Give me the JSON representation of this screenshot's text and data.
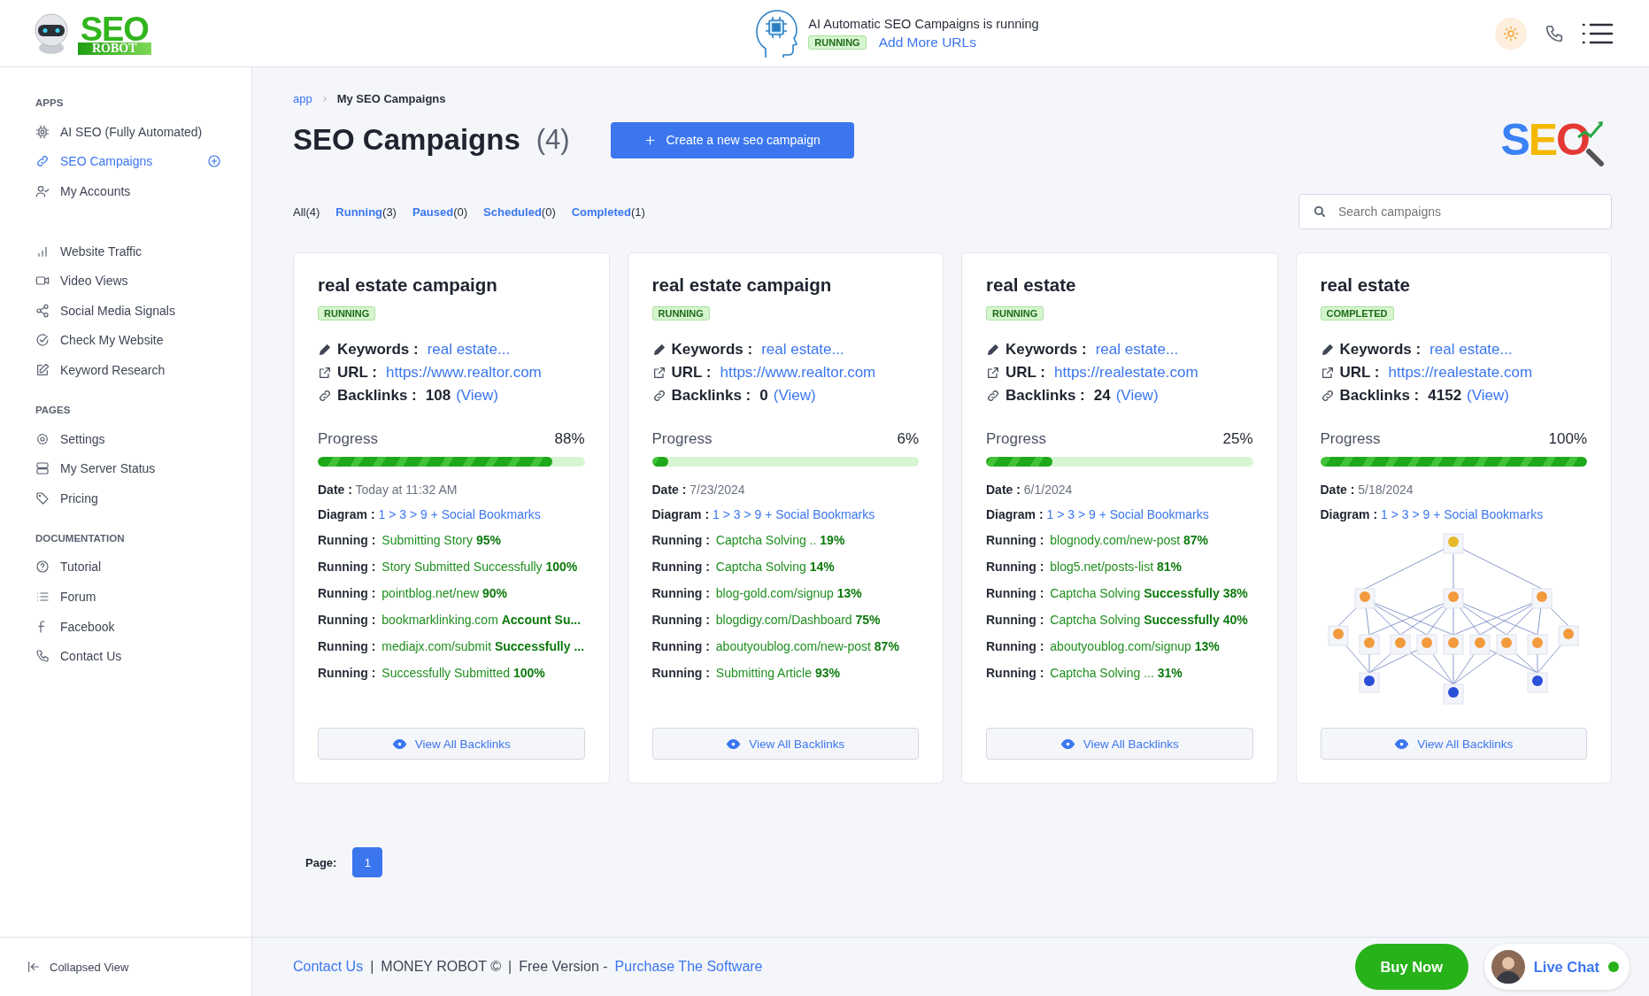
{
  "header": {
    "logo": {
      "title": "SEO",
      "subtitle": "ROBOT"
    },
    "status_text": "AI Automatic SEO Campaigns is running",
    "status_badge": "RUNNING",
    "link": "Add More URLs"
  },
  "sidebar": {
    "sections": [
      {
        "title": "APPS",
        "items": [
          {
            "label": "AI SEO (Fully Automated)",
            "selected": false,
            "kind": "plain"
          },
          {
            "label": "SEO Campaigns",
            "selected": true,
            "kind": "with-add"
          },
          {
            "label": "My Accounts",
            "selected": false,
            "kind": "plain"
          }
        ]
      },
      {
        "items": [
          {
            "label": "Website Traffic",
            "selected": false,
            "kind": "plain"
          },
          {
            "label": "Video Views",
            "selected": false,
            "kind": "plain"
          },
          {
            "label": "Social Media Signals",
            "selected": false,
            "kind": "plain"
          },
          {
            "label": "Check My Website",
            "selected": false,
            "kind": "plain"
          },
          {
            "label": "Keyword Research",
            "selected": false,
            "kind": "plain"
          }
        ]
      },
      {
        "title": "PAGES",
        "items": [
          {
            "label": "Settings",
            "selected": false,
            "kind": "plain"
          },
          {
            "label": "My Server Status",
            "selected": false,
            "kind": "plain"
          },
          {
            "label": "Pricing",
            "selected": false,
            "kind": "plain"
          }
        ]
      },
      {
        "title": "DOCUMENTATION",
        "items": [
          {
            "label": "Tutorial",
            "selected": false,
            "kind": "plain"
          },
          {
            "label": "Forum",
            "selected": false,
            "kind": "plain"
          },
          {
            "label": "Facebook",
            "selected": false,
            "kind": "plain"
          },
          {
            "label": "Contact Us",
            "selected": false,
            "kind": "plain"
          }
        ]
      }
    ],
    "collapse": "Collapsed View"
  },
  "breadcrumb": [
    "app",
    "My SEO Campaigns"
  ],
  "page_title": "SEO Campaigns",
  "page_count": "(4)",
  "create_button": "Create a new seo campaign",
  "brand_mark": "SEO",
  "tabs": [
    {
      "label": "All",
      "count": "(4)",
      "selected": true
    },
    {
      "label": "Running",
      "count": "(3)",
      "selected": false
    },
    {
      "label": "Paused",
      "count": "(0)",
      "selected": false
    },
    {
      "label": "Scheduled",
      "count": "(0)",
      "selected": false
    },
    {
      "label": "Completed",
      "count": "(1)",
      "selected": false
    }
  ],
  "search": {
    "placeholder": "Search campaigns"
  },
  "cards": [
    {
      "title": "real estate campaign",
      "status": "RUNNING",
      "keywords_label": "Keywords :",
      "keywords": "real estate...",
      "url_label": "URL :",
      "url": "https://www.realtor.com",
      "backlinks_label": "Backlinks :",
      "backlinks": "108",
      "view_link": "(View)",
      "progress_label": "Progress",
      "level": 0.88,
      "reading": "88%",
      "date_label": "Date :",
      "date": "Today at 11:32 AM",
      "diagram_label": "Diagram :",
      "diagram": "1 > 3 > 9 + Social Bookmarks",
      "kind": "activity",
      "running": [
        {
          "label": "Running :",
          "text": "Submitting Story **95%**"
        },
        {
          "label": "Running :",
          "text": "Story Submitted Successfully **100%**"
        },
        {
          "label": "Running :",
          "text": "pointblog.net/new **90%**"
        },
        {
          "label": "Running :",
          "text": "bookmarklinking.com **Account Su...**"
        },
        {
          "label": "Running :",
          "text": "mediajx.com/submit **Successfully ...**"
        },
        {
          "label": "Running :",
          "text": "Successfully Submitted **100%**"
        }
      ],
      "button": "View All Backlinks"
    },
    {
      "title": "real estate campaign",
      "status": "RUNNING",
      "keywords_label": "Keywords :",
      "keywords": "real estate...",
      "url_label": "URL :",
      "url": "https://www.realtor.com",
      "backlinks_label": "Backlinks :",
      "backlinks": "0",
      "view_link": "(View)",
      "progress_label": "Progress",
      "level": 0.06,
      "reading": "6%",
      "date_label": "Date :",
      "date": "7/23/2024",
      "diagram_label": "Diagram :",
      "diagram": "1 > 3 > 9 + Social Bookmarks",
      "kind": "activity",
      "running": [
        {
          "label": "Running :",
          "text": "Captcha Solving .. **19%**"
        },
        {
          "label": "Running :",
          "text": "Captcha Solving **14%**"
        },
        {
          "label": "Running :",
          "text": "blog-gold.com/signup **13%**"
        },
        {
          "label": "Running :",
          "text": "blogdigy.com/Dashboard **75%**"
        },
        {
          "label": "Running :",
          "text": "aboutyoublog.com/new-post **87%**"
        },
        {
          "label": "Running :",
          "text": "Submitting Article **93%**"
        }
      ],
      "button": "View All Backlinks"
    },
    {
      "title": "real estate",
      "status": "RUNNING",
      "keywords_label": "Keywords :",
      "keywords": "real estate...",
      "url_label": "URL :",
      "url": "https://realestate.com",
      "backlinks_label": "Backlinks :",
      "backlinks": "24",
      "view_link": "(View)",
      "progress_label": "Progress",
      "level": 0.25,
      "reading": "25%",
      "date_label": "Date :",
      "date": "6/1/2024",
      "diagram_label": "Diagram :",
      "diagram": "1 > 3 > 9 + Social Bookmarks",
      "kind": "activity",
      "running": [
        {
          "label": "Running :",
          "text": "blognody.com/new-post **87%**"
        },
        {
          "label": "Running :",
          "text": "blog5.net/posts-list **81%**"
        },
        {
          "label": "Running :",
          "text": "Captcha Solving **Successfully 38%**"
        },
        {
          "label": "Running :",
          "text": "Captcha Solving **Successfully 40%**"
        },
        {
          "label": "Running :",
          "text": "aboutyoublog.com/signup **13%**"
        },
        {
          "label": "Running :",
          "text": "Captcha Solving ... **31%**"
        }
      ],
      "button": "View All Backlinks"
    },
    {
      "title": "real estate",
      "status": "COMPLETED",
      "keywords_label": "Keywords :",
      "keywords": "real estate...",
      "url_label": "URL :",
      "url": "https://realestate.com",
      "backlinks_label": "Backlinks :",
      "backlinks": "4152",
      "view_link": "(View)",
      "progress_label": "Progress",
      "level": 1,
      "reading": "100%",
      "date_label": "Date :",
      "date": "5/18/2024",
      "diagram_label": "Diagram :",
      "diagram": "1 > 3 > 9 + Social Bookmarks",
      "kind": "diagram",
      "button": "View All Backlinks"
    }
  ],
  "pagination": {
    "label": "Page:",
    "pages": [
      {
        "label": "1",
        "selected": true
      }
    ]
  },
  "footer": [
    {
      "text": "Contact Us",
      "kind": "link"
    },
    {
      "text": "|",
      "kind": "sep"
    },
    {
      "text": "MONEY ROBOT ©",
      "kind": "text"
    },
    {
      "text": "|",
      "kind": "sep"
    },
    {
      "text": "Free Version -",
      "kind": "text"
    },
    {
      "text": "Purchase The Software",
      "kind": "link"
    }
  ],
  "buy_button": "Buy Now",
  "live_chat": {
    "label": "Live Chat",
    "online": true
  }
}
